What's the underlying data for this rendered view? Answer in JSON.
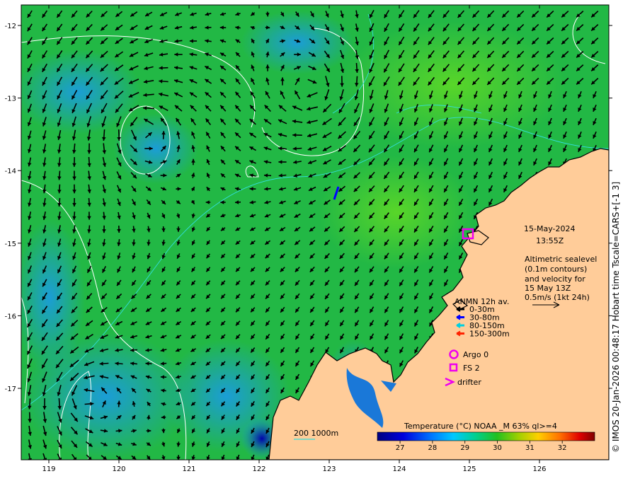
{
  "date": {
    "line1": "15-May-2024",
    "line2": "13:55Z"
  },
  "description": [
    "Altimetric sealevel",
    "(0.1m contours)",
    "and velocity for",
    "15 May 13Z",
    "0.5m/s (1kt 24h)"
  ],
  "anmn": {
    "title": "ANMN 12h av.",
    "items": [
      {
        "label": "0-30m",
        "color": "#000000"
      },
      {
        "label": "30-80m",
        "color": "#0000ff"
      },
      {
        "label": "80-150m",
        "color": "#00cfe0"
      },
      {
        "label": "150-300m",
        "color": "#ff2200"
      }
    ]
  },
  "platforms": {
    "argo": "Argo 0",
    "fs": "FS 2",
    "drifter": "drifter",
    "color": "#ee00ee"
  },
  "bathy": {
    "label": "200  1000m"
  },
  "colorbar": {
    "title": "Temperature (°C) NOAA _M 63% ql>=4",
    "ticks": [
      "27",
      "28",
      "29",
      "30",
      "31",
      "32"
    ],
    "vmin": 26.3,
    "vmax": 33.0
  },
  "axes": {
    "lon_ticks": [
      "119",
      "120",
      "121",
      "122",
      "123",
      "124",
      "125",
      "126"
    ],
    "lat_ticks": [
      "-12",
      "-13",
      "-14",
      "-15",
      "-16",
      "-17"
    ]
  },
  "credit": "© IMOS 20-Jan-2026 00:48:17 Hobart time Tscale=CARS+[-1 3]",
  "colors": {
    "land": "#ffcc99",
    "sea_main": "#22b845",
    "sea_cool": "#1a9ae6",
    "contour": "#ffffff",
    "isobath": "#33dddd"
  }
}
